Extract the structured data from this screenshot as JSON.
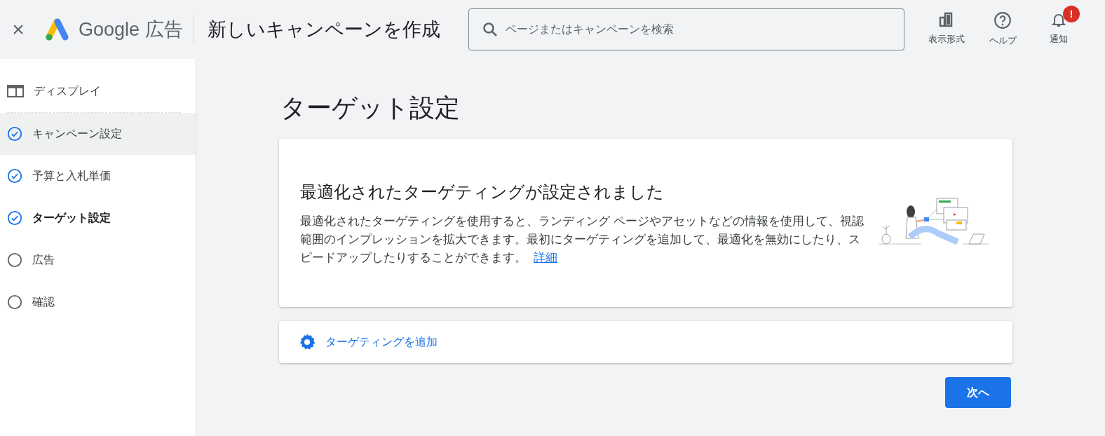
{
  "header": {
    "close": "×",
    "brand": "Google",
    "product": "広告",
    "title": "新しいキャンペーンを作成",
    "search": {
      "placeholder": "ページまたはキャンペーンを検索"
    },
    "actions": [
      {
        "kind": "view",
        "label": "表示形式"
      },
      {
        "kind": "help",
        "label": "ヘルプ"
      },
      {
        "kind": "notifications",
        "label": "通知",
        "badge": "!"
      }
    ]
  },
  "sidebar": {
    "campaign_type": "ディスプレイ",
    "steps": [
      {
        "label": "キャンペーン設定",
        "completed": true,
        "selected": false,
        "hovered": true
      },
      {
        "label": "予算と入札単価",
        "completed": true,
        "selected": false,
        "hovered": false
      },
      {
        "label": "ターゲット設定",
        "completed": true,
        "selected": true,
        "hovered": false
      },
      {
        "label": "広告",
        "completed": false,
        "selected": false,
        "hovered": false
      },
      {
        "label": "確認",
        "completed": false,
        "selected": false,
        "hovered": false
      }
    ]
  },
  "main": {
    "heading": "ターゲット設定",
    "card": {
      "title": "最適化されたターゲティングが設定されました",
      "body": "最適化されたターゲティングを使用すると、ランディング ページやアセットなどの情報を使用して、視認範囲のインプレッションを拡大できます。最初にターゲティングを追加して、最適化を無効にしたり、スピードアップしたりすることができます。",
      "link": "詳細"
    },
    "add_targeting": "ターゲティングを追加",
    "next": "次へ"
  }
}
